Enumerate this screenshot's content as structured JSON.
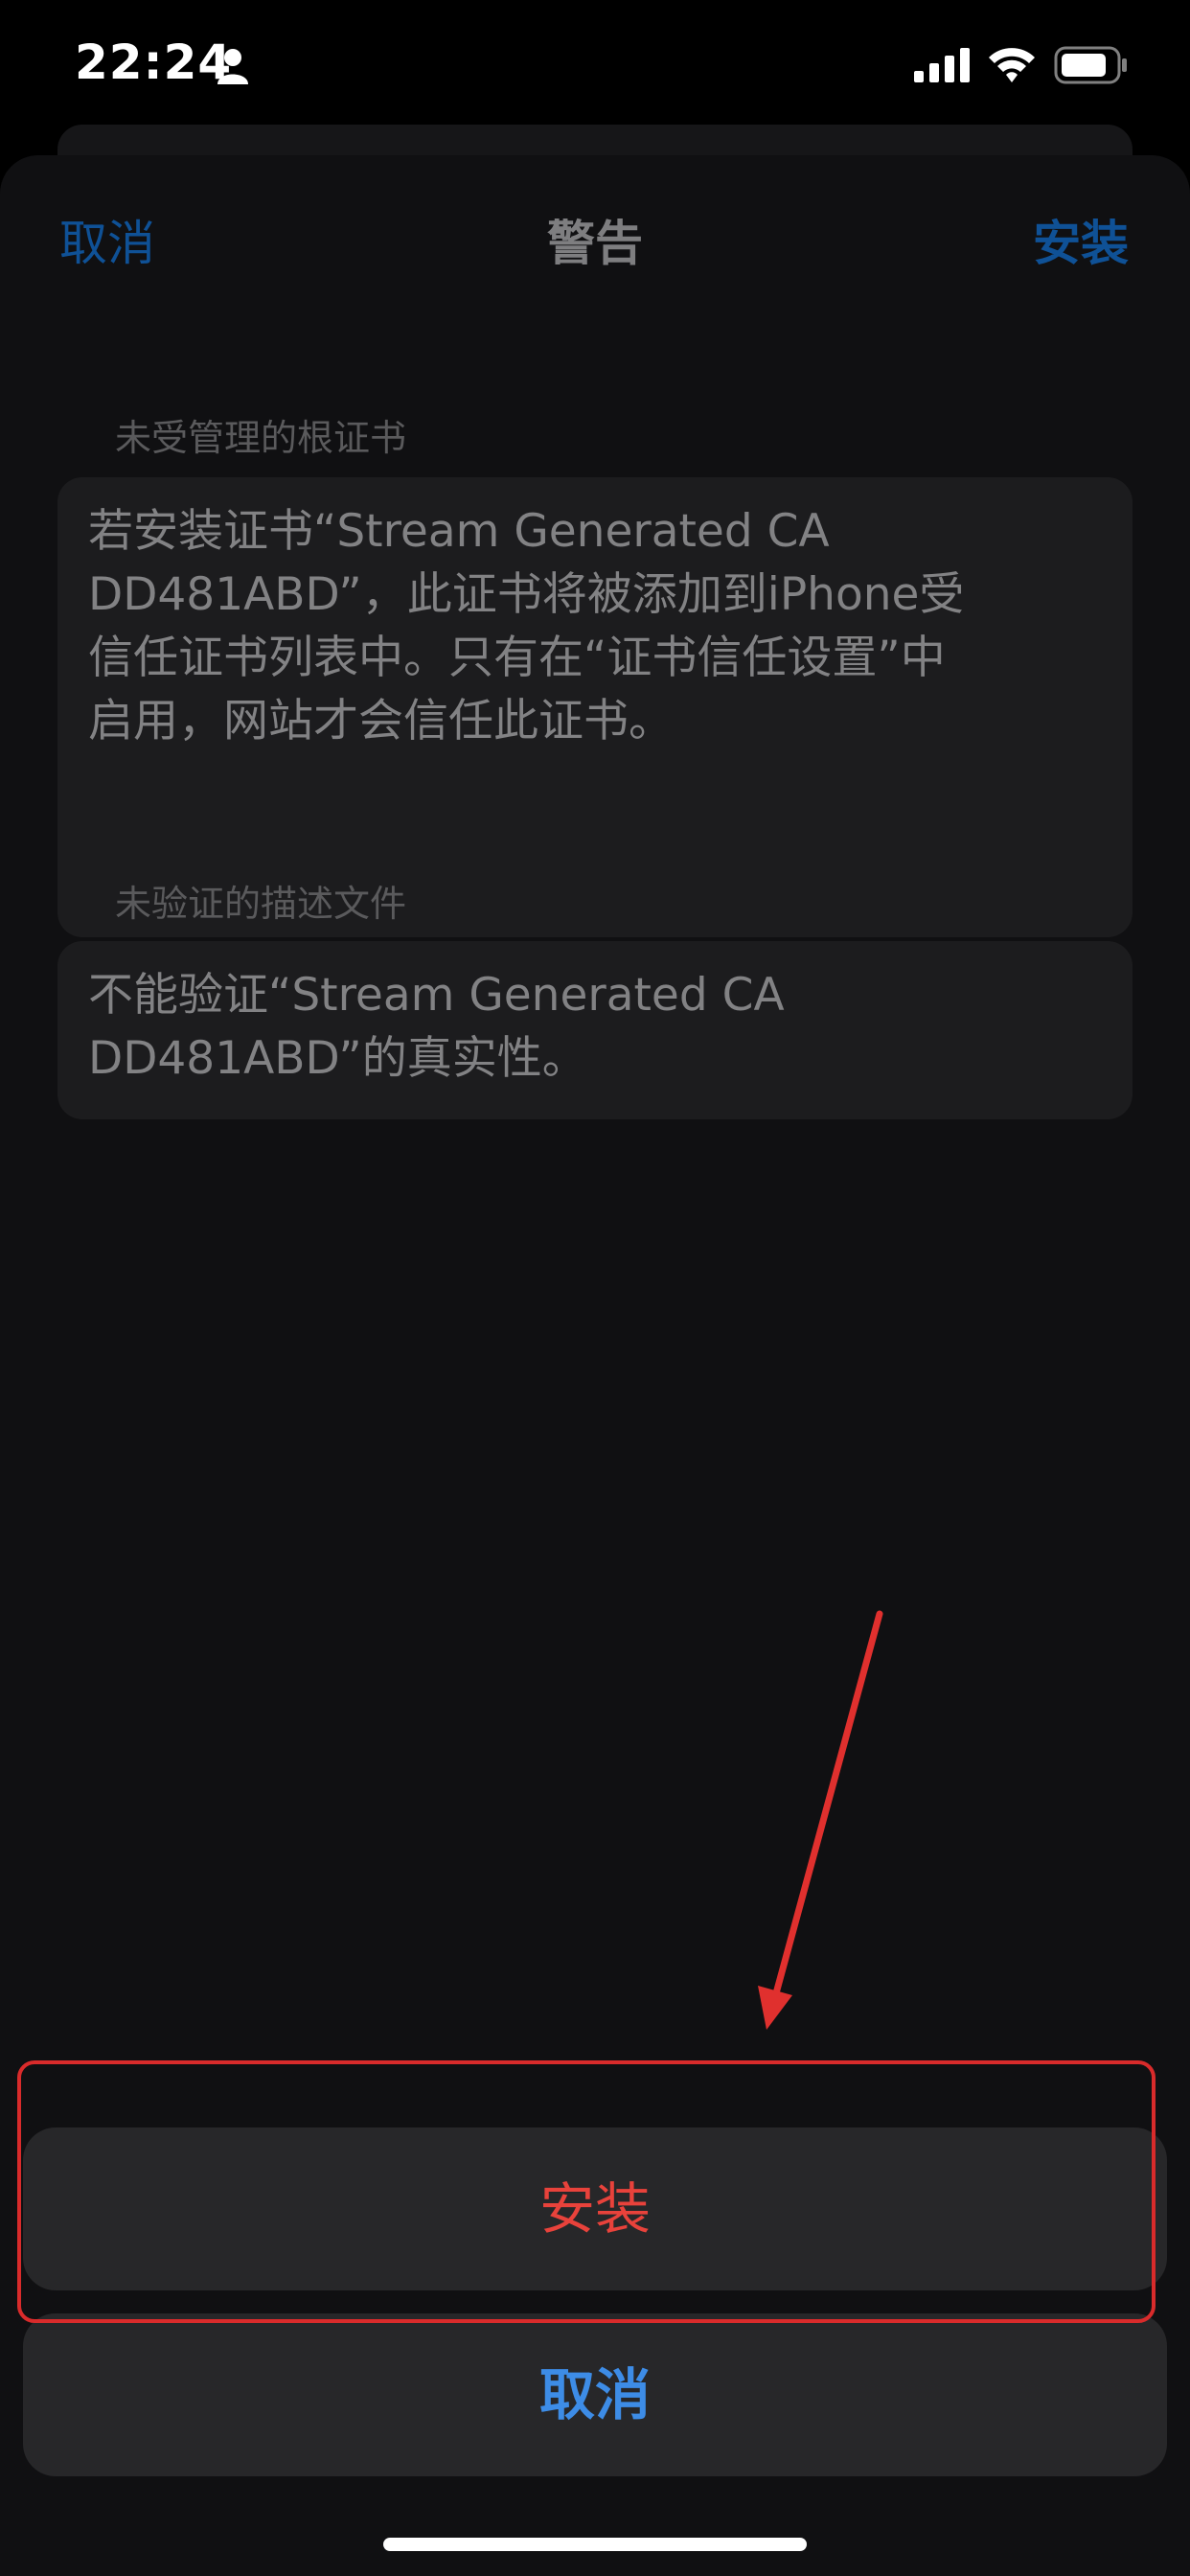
{
  "status_bar": {
    "time": "22:24",
    "icons": [
      "person-icon",
      "signal-icon",
      "wifi-icon",
      "battery-icon"
    ]
  },
  "nav": {
    "cancel_label": "取消",
    "title": "警告",
    "install_label": "安装"
  },
  "sections": [
    {
      "header": "未受管理的根证书",
      "lines": [
        "若安装证书“Stream Generated CA",
        "DD481ABD”，此证书将被添加到iPhone受",
        "信任证书列表中。只有在“证书信任设置”中",
        "启用，网站才会信任此证书。"
      ]
    },
    {
      "header": "未验证的描述文件",
      "lines": [
        "不能验证“Stream Generated CA",
        "DD481ABD”的真实性。"
      ]
    }
  ],
  "action_sheet": {
    "install_label": "安装",
    "cancel_label": "取消"
  },
  "colors": {
    "nav_link": "#0f5196",
    "destructive": "#e8423b",
    "action_cancel": "#3d8ce6",
    "annotation": "#e0302e"
  }
}
